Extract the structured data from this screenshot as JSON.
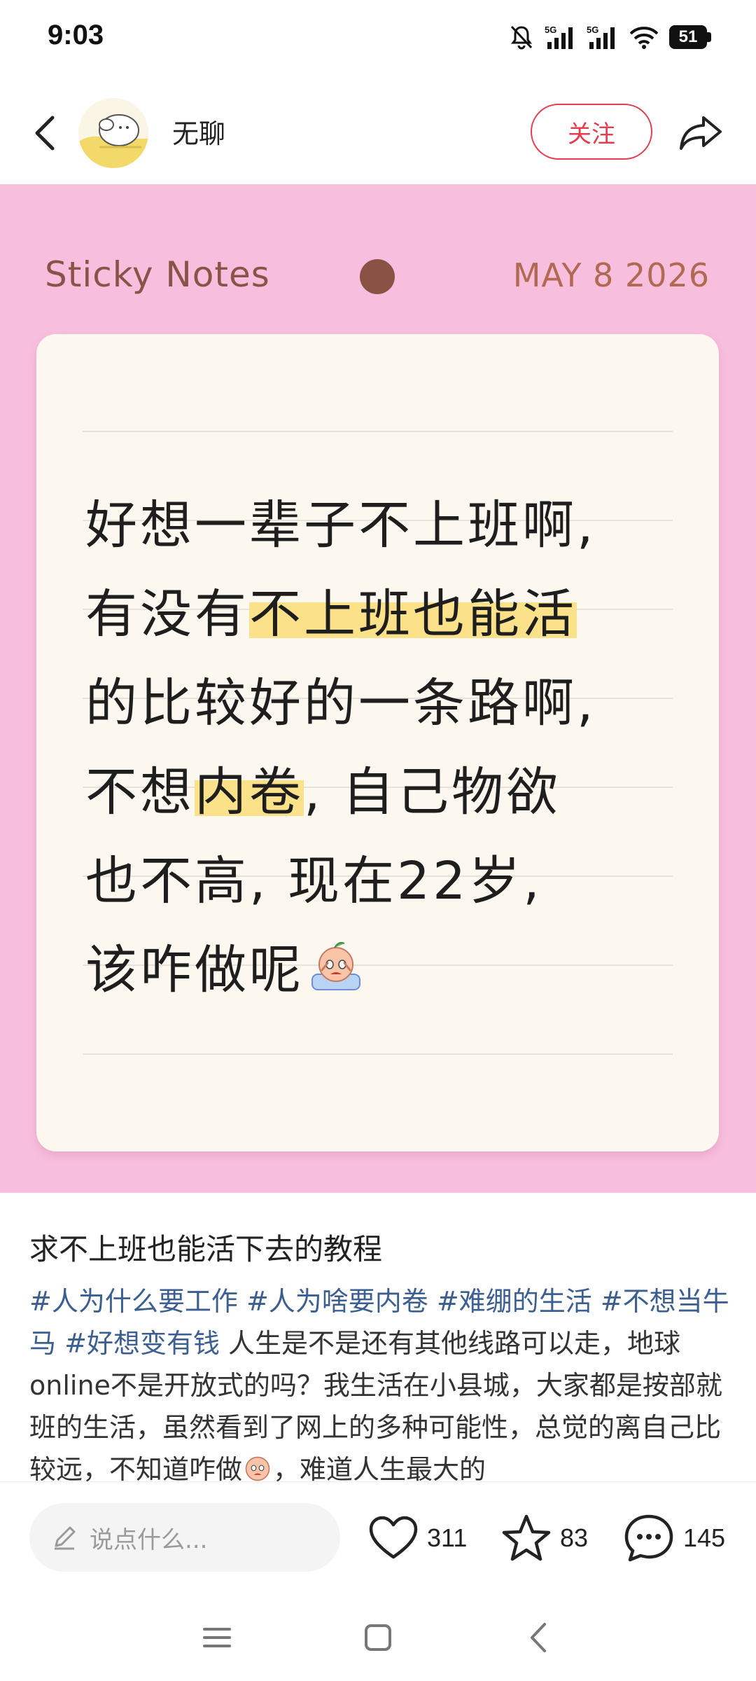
{
  "status_bar": {
    "time": "9:03",
    "network1": "5G",
    "network2": "5G",
    "battery": "51"
  },
  "header": {
    "author": "无聊",
    "follow_label": "关注"
  },
  "image": {
    "title": "Sticky Notes",
    "date": "MAY 8 2026",
    "lines": [
      {
        "before": "好想一辈子不上班啊,",
        "highlight": "",
        "after": ""
      },
      {
        "before": "有没有",
        "highlight": "不上班也能活",
        "after": ""
      },
      {
        "before": "的比较好的一条路啊,",
        "highlight": "",
        "after": ""
      },
      {
        "before": "不想",
        "highlight": "内卷",
        "after": ", 自己物欲"
      },
      {
        "before": "也不高, 现在22岁,",
        "highlight": "",
        "after": ""
      },
      {
        "before": "该咋做呢",
        "highlight": "",
        "after": ""
      }
    ],
    "highlight_color": "#fbe18a",
    "background_color": "#f8bede"
  },
  "post": {
    "title": "求不上班也能活下去的教程",
    "tags": [
      "#人为什么要工作",
      "#人为啥要内卷",
      "#难绷的生活",
      "#不想当牛马",
      "#好想变有钱"
    ],
    "body_part1": "人生是不是还有其他线路可以走，地球online不是开放式的吗？我生活在小县城，大家都是按部就班的生活，虽然看到了网上的多种可能性，总觉的离自己比较远，不知道咋做",
    "body_part2": "，难道人生最大的"
  },
  "actions": {
    "comment_placeholder": "说点什么...",
    "likes": "311",
    "favorites": "83",
    "comments": "145"
  },
  "icons": {
    "back": "back-arrow-icon",
    "share": "share-icon",
    "pen": "pen-icon",
    "like": "heart-icon",
    "favorite": "star-icon",
    "comment": "comment-bubble-icon",
    "menu": "menu-icon",
    "home": "home-square-icon",
    "nav_back": "nav-back-icon"
  }
}
